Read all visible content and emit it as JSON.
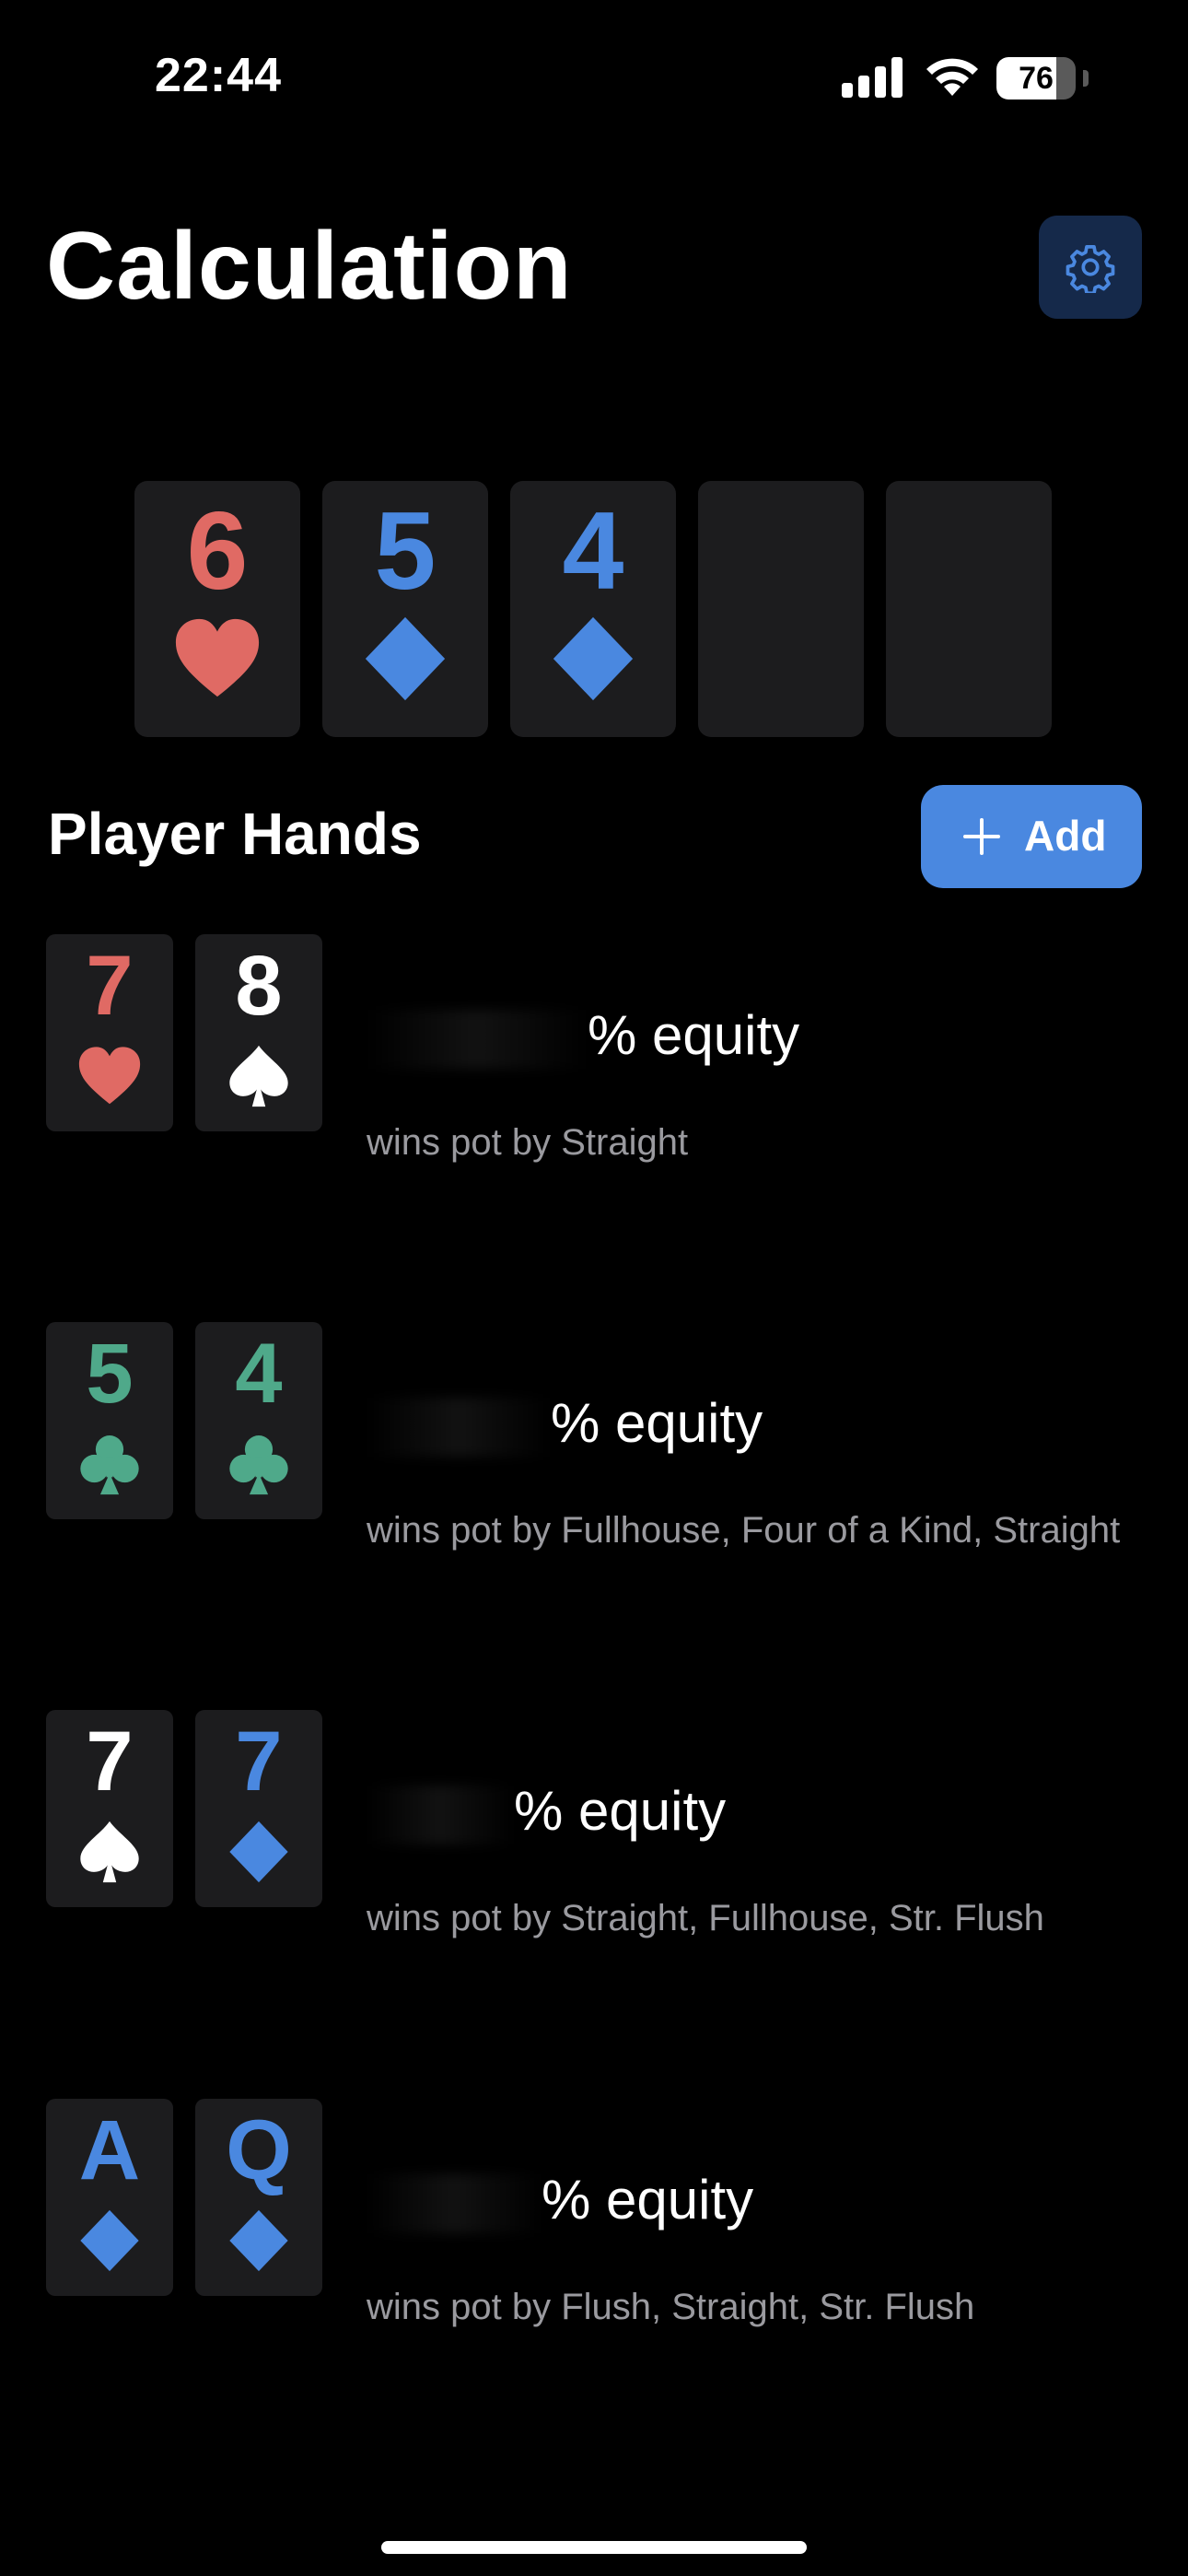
{
  "status_bar": {
    "time": "22:44",
    "battery": "76",
    "battery_level": 0.76
  },
  "header": {
    "title": "Calculation"
  },
  "board": [
    {
      "rank": "6",
      "suit": "heart",
      "color": "#e06a64"
    },
    {
      "rank": "5",
      "suit": "diamond",
      "color": "#4a88e0"
    },
    {
      "rank": "4",
      "suit": "diamond",
      "color": "#4a88e0"
    },
    {
      "rank": "",
      "suit": "",
      "color": ""
    },
    {
      "rank": "",
      "suit": "",
      "color": ""
    }
  ],
  "player_hands": {
    "title": "Player Hands",
    "add_label": "Add",
    "hands": [
      {
        "cards": [
          {
            "rank": "7",
            "suit": "heart",
            "color": "#e06a64"
          },
          {
            "rank": "8",
            "suit": "spade",
            "color": "#ffffff"
          }
        ],
        "equity_label": "% equity",
        "wins": "wins pot by Straight"
      },
      {
        "cards": [
          {
            "rank": "5",
            "suit": "club",
            "color": "#4fa98a"
          },
          {
            "rank": "4",
            "suit": "club",
            "color": "#4fa98a"
          }
        ],
        "equity_label": "% equity",
        "wins": "wins pot by Fullhouse, Four of a Kind, Straight"
      },
      {
        "cards": [
          {
            "rank": "7",
            "suit": "spade",
            "color": "#ffffff"
          },
          {
            "rank": "7",
            "suit": "diamond",
            "color": "#4a88e0"
          }
        ],
        "equity_label": "% equity",
        "wins": "wins pot by Straight, Fullhouse, Str. Flush"
      },
      {
        "cards": [
          {
            "rank": "A",
            "suit": "diamond",
            "color": "#4a88e0"
          },
          {
            "rank": "Q",
            "suit": "diamond",
            "color": "#4a88e0"
          }
        ],
        "equity_label": "% equity",
        "wins": "wins pot by Flush, Straight, Str. Flush"
      }
    ]
  },
  "colors": {
    "accent": "#4a88e0",
    "card_bg": "#1c1c1e",
    "settings_bg": "#15294a",
    "secondary_text": "#9a9a9f"
  },
  "icons": {
    "settings": "gear-icon",
    "add": "plus-icon"
  }
}
